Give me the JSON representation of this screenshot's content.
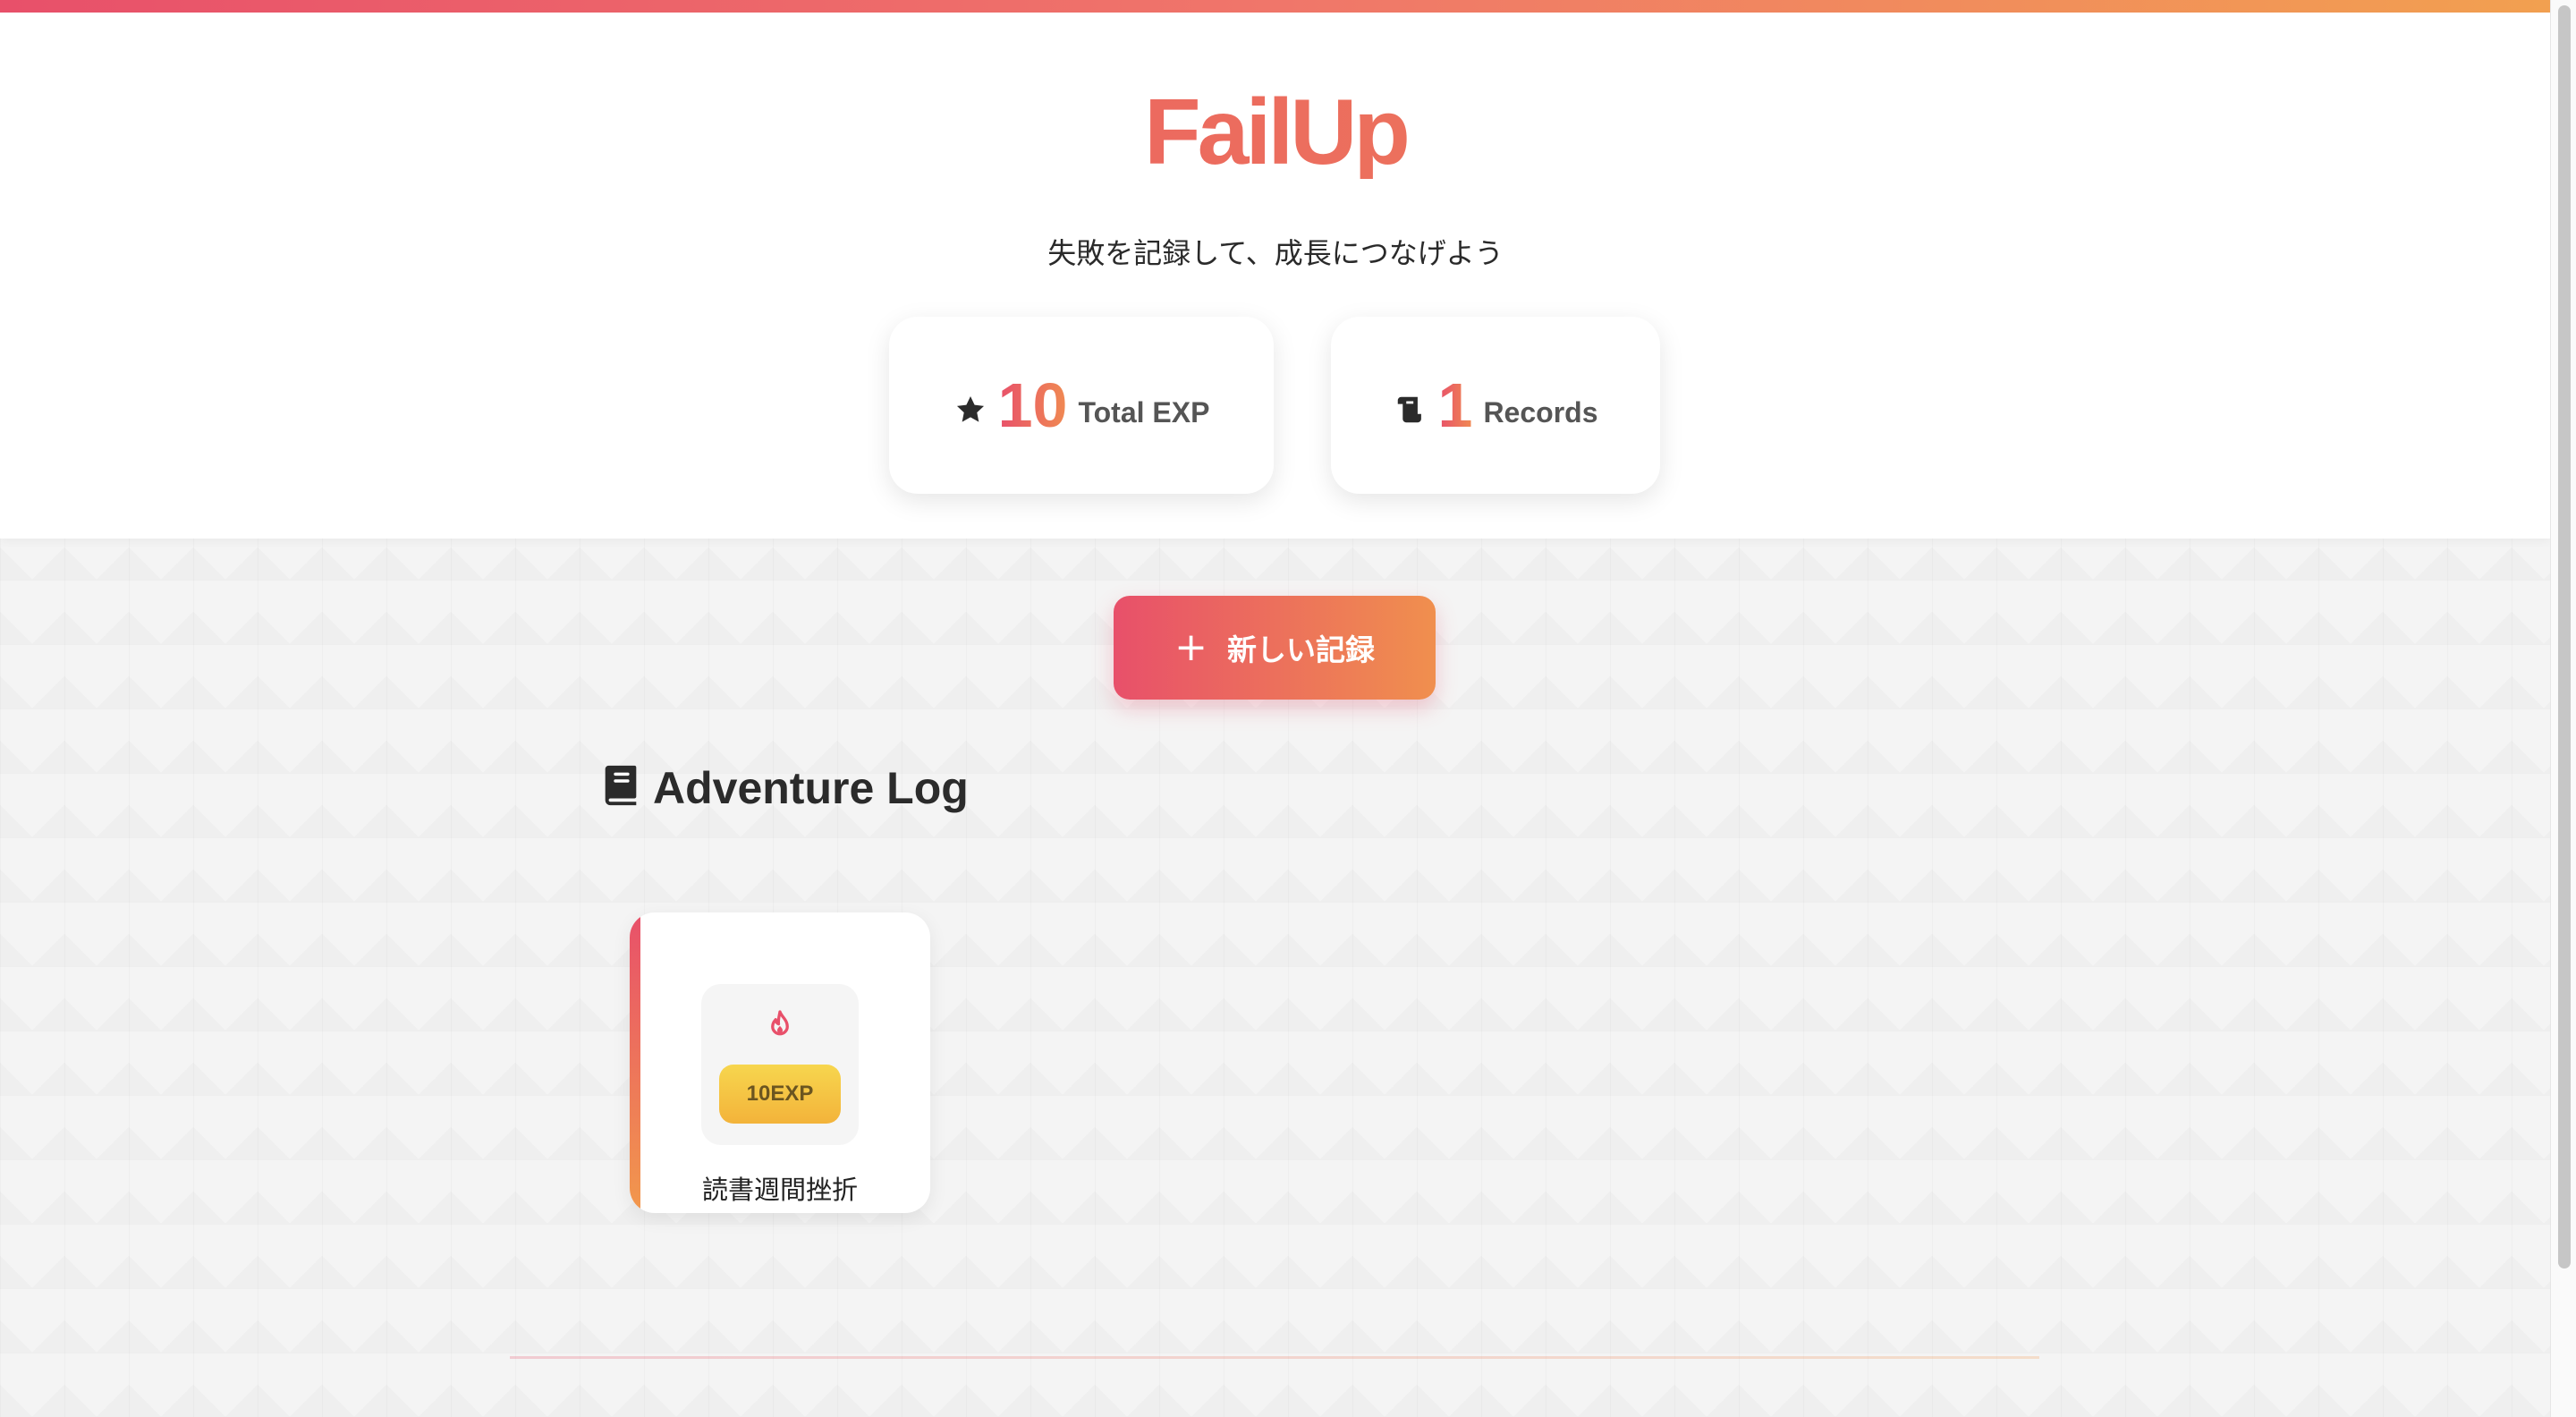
{
  "app": {
    "title": "FailUp",
    "subtitle": "失敗を記録して、成長につなげよう"
  },
  "stats": {
    "exp": {
      "icon": "star-icon",
      "value": "10",
      "label": "Total EXP"
    },
    "records": {
      "icon": "scroll-icon",
      "value": "1",
      "label": "Records"
    }
  },
  "actions": {
    "new_record_icon": "plus-icon",
    "new_record_label": "新しい記録"
  },
  "adventure_log": {
    "icon": "book-icon",
    "title": "Adventure Log",
    "records": [
      {
        "icon": "flame-icon",
        "exp": "10EXP",
        "title": "読書週間挫折"
      }
    ]
  },
  "colors": {
    "accent_start": "#e8506a",
    "accent_end": "#f08f4e",
    "badge": "#f3c13f"
  }
}
